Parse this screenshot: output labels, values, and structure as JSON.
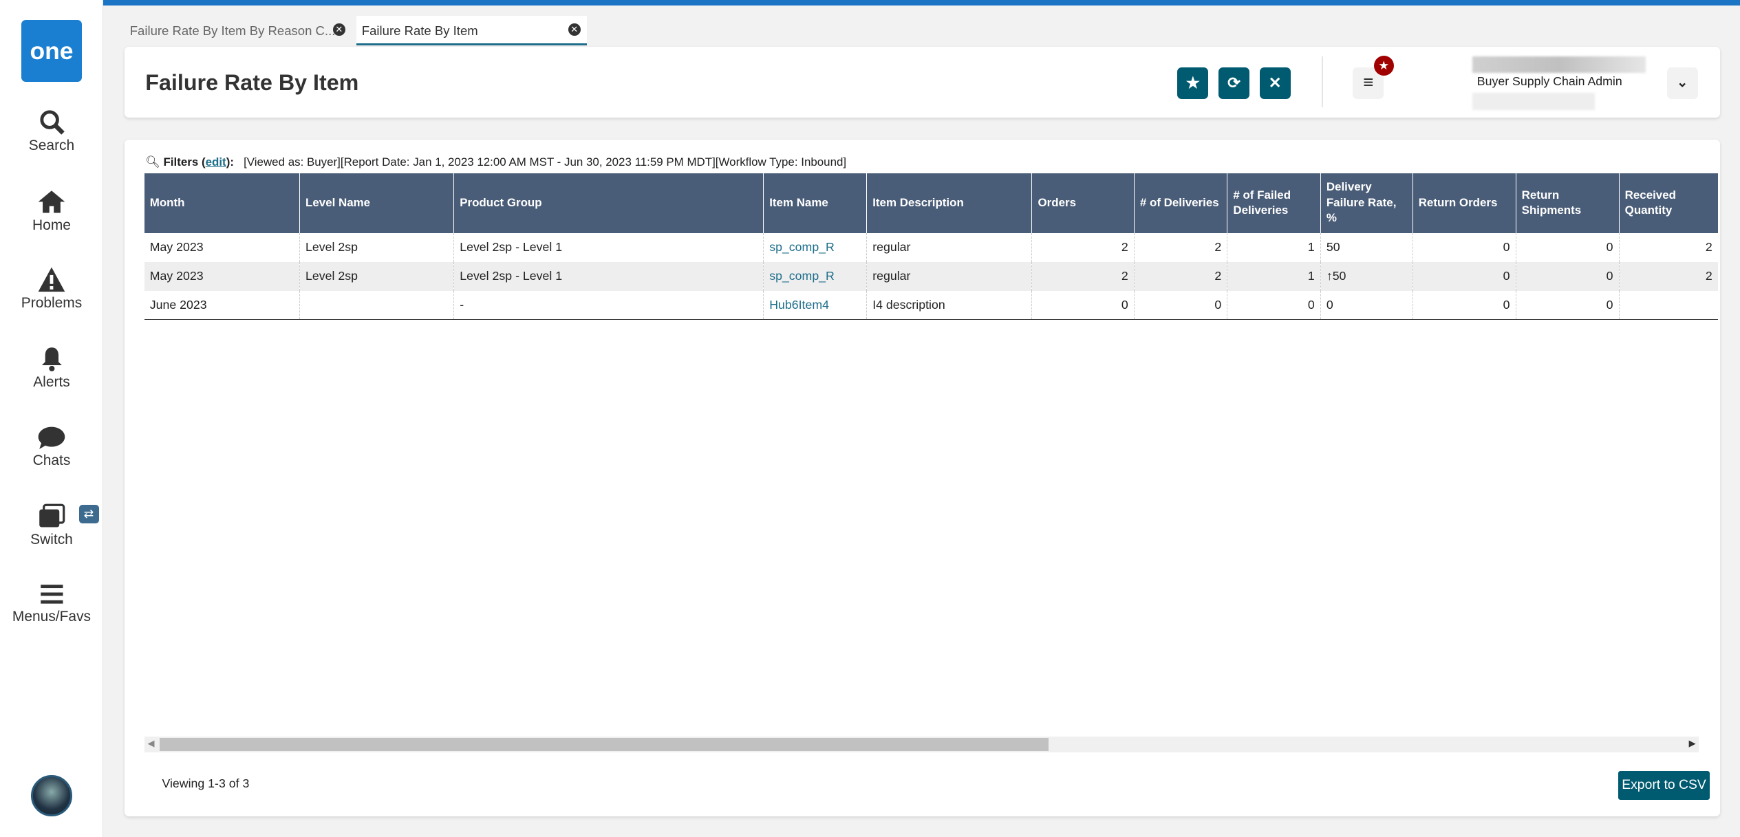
{
  "sidebar": {
    "logo": "one",
    "items": [
      {
        "label": "Search",
        "icon": "search-icon"
      },
      {
        "label": "Home",
        "icon": "home-icon"
      },
      {
        "label": "Problems",
        "icon": "warning-icon"
      },
      {
        "label": "Alerts",
        "icon": "bell-icon"
      },
      {
        "label": "Chats",
        "icon": "chat-icon"
      },
      {
        "label": "Switch",
        "icon": "switch-icon"
      },
      {
        "label": "Menus/Favs",
        "icon": "menu-icon"
      }
    ],
    "switch_badge": "⇄"
  },
  "tabs": [
    {
      "label": "Failure Rate By Item By Reason C..."
    },
    {
      "label": "Failure Rate By Item",
      "active": true
    }
  ],
  "header": {
    "title": "Failure Rate By Item",
    "role": "Buyer Supply Chain Admin"
  },
  "filters": {
    "label": "Filters",
    "edit": "edit",
    "text": "[Viewed as: Buyer][Report Date: Jan 1, 2023 12:00 AM MST - Jun 30, 2023 11:59 PM MDT][Workflow Type: Inbound]"
  },
  "table": {
    "columns": [
      "Month",
      "Level Name",
      "Product Group",
      "Item Name",
      "Item Description",
      "Orders",
      "# of Deliveries",
      "# of Failed Deliveries",
      "Delivery Failure Rate, %",
      "Return Orders",
      "Return Shipments",
      "Received Quantity"
    ],
    "rows": [
      [
        "May 2023",
        "Level 2sp",
        "Level 2sp - Level 1",
        "sp_comp_R",
        "regular",
        "2",
        "2",
        "1",
        "50",
        "0",
        "0",
        "2"
      ],
      [
        "May 2023",
        "Level 2sp",
        "Level 2sp - Level 1",
        "sp_comp_R",
        "regular",
        "2",
        "2",
        "1",
        "↑50",
        "0",
        "0",
        "2"
      ],
      [
        "June 2023",
        "",
        "  -",
        "Hub6Item4",
        "I4 description",
        "0",
        "0",
        "0",
        "0",
        "0",
        "0",
        ""
      ]
    ]
  },
  "footer": {
    "viewing": "Viewing 1-3 of 3",
    "export": "Export to CSV"
  },
  "colors": {
    "accent": "#005a70",
    "header": "#4a5d78",
    "topbar": "#1c74c4",
    "badge": "#a00000"
  }
}
